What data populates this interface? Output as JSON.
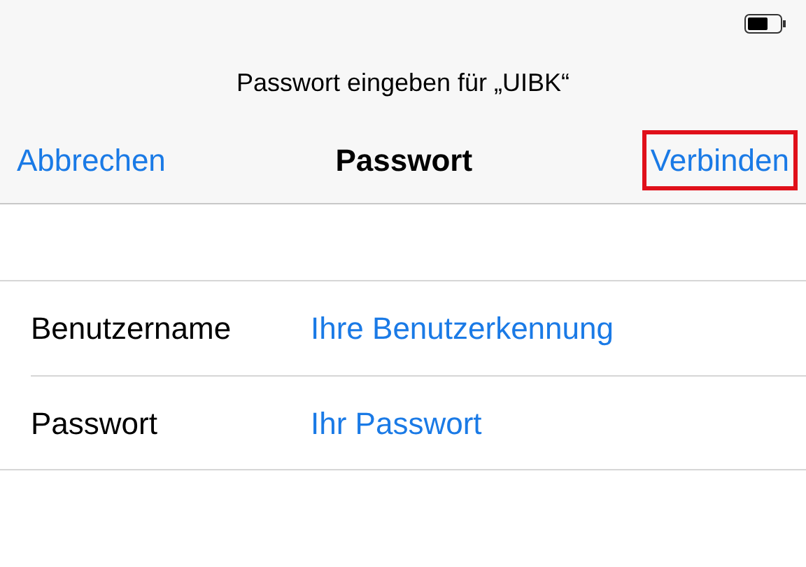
{
  "prompt": "Passwort eingeben für „UIBK“",
  "nav": {
    "cancel": "Abbrechen",
    "title": "Passwort",
    "confirm": {
      "label": "Verbinden",
      "highlighted": true
    }
  },
  "fields": [
    {
      "label": "Benutzername",
      "value": "Ihre Benutzerkennung"
    },
    {
      "label": "Passwort",
      "value": "Ihr Passwort"
    }
  ]
}
